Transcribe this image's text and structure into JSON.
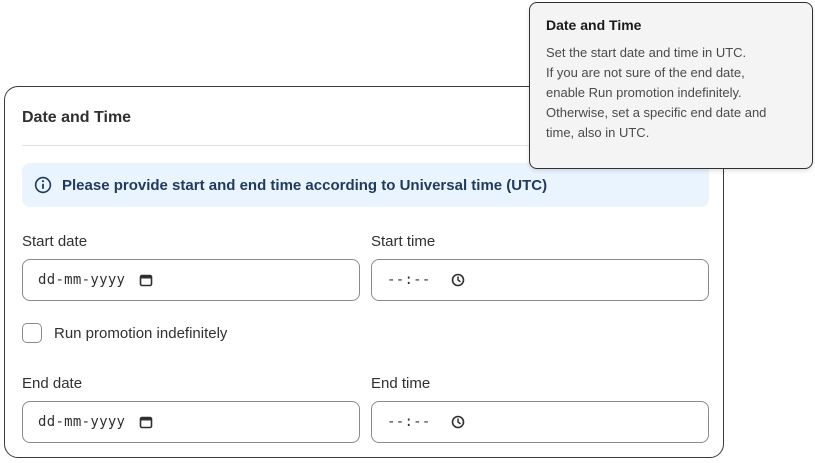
{
  "card": {
    "title": "Date and Time",
    "banner_text": "Please provide start and end time according to Universal time (UTC)",
    "banner_icon": "info-icon",
    "start_date": {
      "label": "Start date",
      "placeholder": "dd-mm-yyyy",
      "icon": "calendar-icon"
    },
    "start_time": {
      "label": "Start time",
      "placeholder": "--:--",
      "icon": "clock-icon"
    },
    "indefinite": {
      "label": "Run promotion indefinitely",
      "checked": false
    },
    "end_date": {
      "label": "End date",
      "placeholder": "dd-mm-yyyy",
      "icon": "calendar-icon"
    },
    "end_time": {
      "label": "End time",
      "placeholder": "--:--",
      "icon": "clock-icon"
    }
  },
  "tooltip": {
    "title": "Date and Time",
    "lines": [
      "Set the start date and time in UTC.",
      "If you are not sure of the end date,",
      "enable Run promotion indefinitely.",
      "Otherwise, set a specific end date and",
      "time, also in UTC."
    ]
  },
  "colors": {
    "banner_bg": "#eaf4ff",
    "banner_text": "#1f3a5c",
    "tooltip_bg": "#f4f4f4",
    "border": "#8a8a8a"
  }
}
